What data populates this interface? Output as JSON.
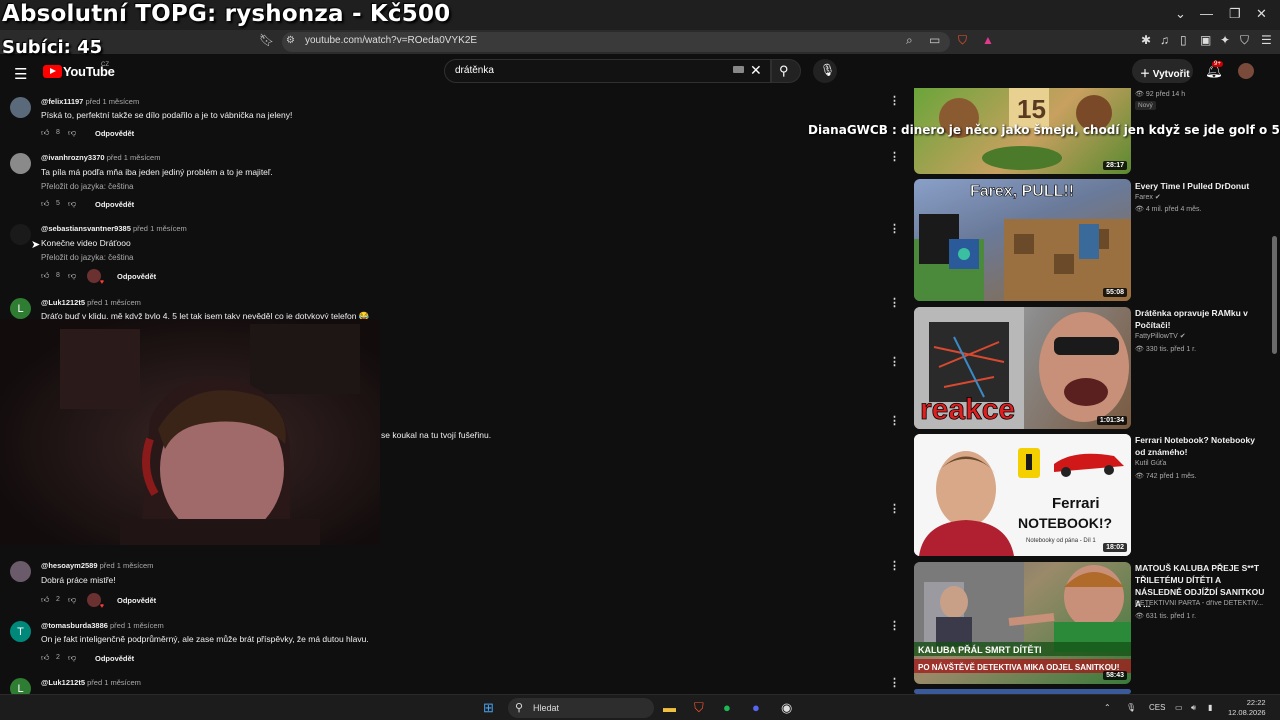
{
  "overlay": {
    "title": "Absolutní TOPG: ryshonza - Kč500",
    "subs": "Subíci: 45",
    "chat_user": "DianaGWCB",
    "chat_message": ": dinero je něco jako šmejd, chodí jen když se jde golf o 500"
  },
  "browser": {
    "url": "youtube.com/watch?v=ROeda0VYK2E"
  },
  "header": {
    "logo_text": "YouTube",
    "region": "CZ",
    "search_value": "drátěnka",
    "create_label": "Vytvořit",
    "notif_badge": "9+"
  },
  "comments": [
    {
      "handle": "@felix11197",
      "time": "před 1 měsícem",
      "text": "Píská to, perfektní takže se dílo podařilo a je to vábnička na jeleny!",
      "likes": "8",
      "reply": "Odpovědět",
      "translate": "",
      "avatar_letter": "",
      "avatar_color": "#5a6a7a"
    },
    {
      "handle": "@ivanhrozny3370",
      "time": "před 1 měsícem",
      "text": "Ta píla má podľa mňa iba jeden jediný problém a to je majiteľ.",
      "likes": "5",
      "reply": "Odpovědět",
      "translate": "Přeložit do jazyka: čeština",
      "avatar_letter": "",
      "avatar_color": "#8a8a8a"
    },
    {
      "handle": "@sebastiansvantner9385",
      "time": "před 1 měsícem",
      "text": "Konečne video Dráťooo",
      "likes": "8",
      "reply": "Odpovědět",
      "translate": "Přeložit do jazyka: čeština",
      "avatar_letter": "",
      "avatar_color": "#1a1a1a"
    },
    {
      "handle": "@Luk1212t5",
      "time": "před 1 měsícem",
      "text": "Dráťo buď v klidu, mě když bylo 4, 5 let tak jsem taky nevěděl co je dotykový telefon 😂",
      "likes": "",
      "reply": "",
      "translate": "",
      "avatar_letter": "L",
      "avatar_color": "#2e7d32"
    },
    {
      "handle": "@hesoaym2589",
      "time": "před 1 měsícem",
      "text": "Dobrá práce mistře!",
      "likes": "2",
      "reply": "Odpovědět",
      "translate": "",
      "avatar_letter": "",
      "avatar_color": "#6a5a6a"
    },
    {
      "handle": "@tomasburda3886",
      "time": "před 1 měsícem",
      "text": "On je fakt inteligenčně podprůměrný, ale zase může brát příspěvky, že má dutou hlavu.",
      "likes": "2",
      "reply": "Odpovědět",
      "translate": "",
      "avatar_letter": "T",
      "avatar_color": "#00897b"
    },
    {
      "handle": "@Luk1212t5",
      "time": "před 1 měsícem",
      "text": "",
      "likes": "",
      "reply": "",
      "translate": "",
      "avatar_letter": "L",
      "avatar_color": "#2e7d32"
    }
  ],
  "partial_comment_text": "se koukal na tu tvojí fušeřinu.",
  "recommendations": [
    {
      "title": "",
      "channel": "",
      "meta": "92 před 14 h",
      "badge": "Nový",
      "duration": "28:17"
    },
    {
      "title": "Every Time I Pulled DrDonut",
      "channel": "Farex",
      "meta": "4 mil. před 4 měs.",
      "badge": "",
      "duration": "55:08",
      "thumb_text": "Farex, PULL!!"
    },
    {
      "title": "Drátěnka opravuje RAMku v Počítači!",
      "channel": "FattyPillowTV",
      "meta": "330 tis. před 1 r.",
      "badge": "",
      "duration": "1:01:34",
      "thumb_text": "reakce"
    },
    {
      "title": "Ferrari Notebook? Notebooky od známého!",
      "channel": "Kutil Gúťa",
      "meta": "742 před 1 měs.",
      "badge": "",
      "duration": "18:02",
      "thumb_text1": "Ferrari",
      "thumb_text2": "NOTEBOOK!?",
      "thumb_text3": "Notebooky od pána - Díl 1"
    },
    {
      "title": "MATOUŠ KALUBA PŘEJE S**T TŘILETÉMU DÍTĚTI A NÁSLEDNĚ ODJÍŽDÍ SANITKOU A ...",
      "channel": "DETEKTIVNÍ PARTA - dříve DETEKTIV...",
      "meta": "631 tis. před 1 r.",
      "badge": "",
      "duration": "58:43",
      "thumb_text1": "KALUBA PŘÁL SMRT DÍTĚTI",
      "thumb_text2": "PO NÁVŠTĚVĚ DETEKTIVA MIKA ODJEL SANITKOU!"
    }
  ],
  "taskbar": {
    "search_label": "Hledat",
    "lang": "CES",
    "time": "22:22",
    "date": "12.08.2026"
  }
}
